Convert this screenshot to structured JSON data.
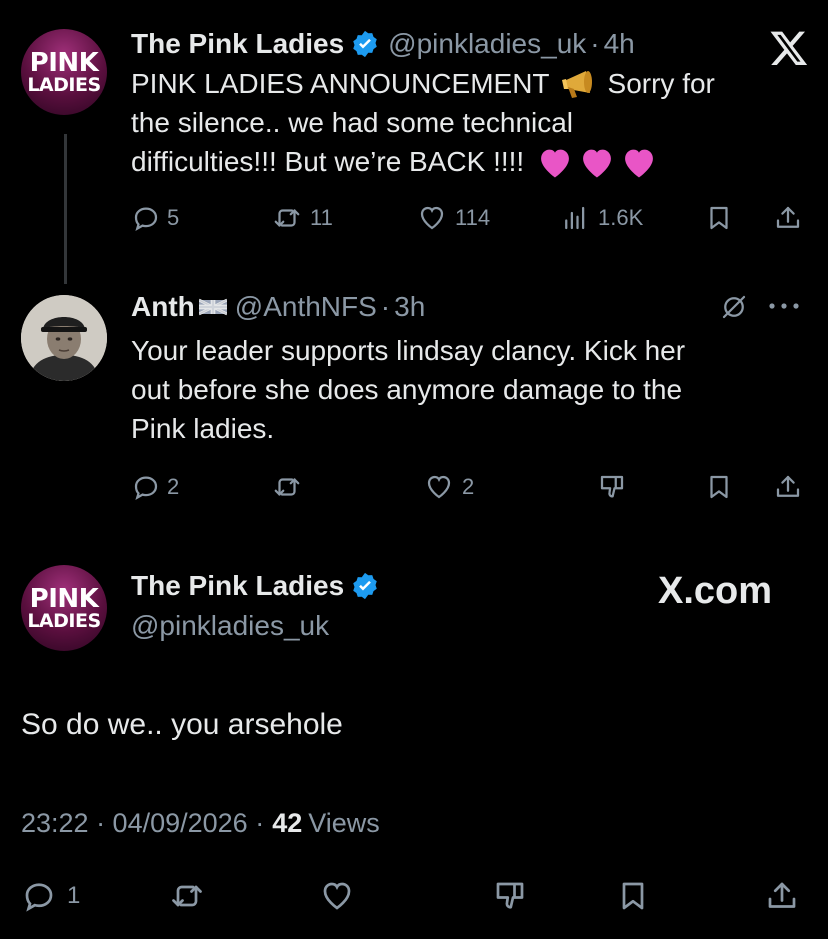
{
  "tweet1": {
    "display_name": "The Pink Ladies",
    "handle": "@pinkladies_uk",
    "time": "4h",
    "avatar_text_line1": "PINK",
    "avatar_text_line2": "LADIES",
    "text_part1": "PINK LADIES ANNOUNCEMENT",
    "text_part2": "Sorry for",
    "text_line2": "the silence.. we had some technical",
    "text_line3": "difficulties!!! But we’re BACK !!!!",
    "hearts": "💗💗💗",
    "megaphone_icon": "megaphone-icon",
    "replies": "5",
    "retweets": "11",
    "likes": "114",
    "views": "1.6K"
  },
  "reply": {
    "display_name": "Anth",
    "flag": "uk-flag-icon",
    "handle": "@AnthNFS",
    "time": "3h",
    "line1": "Your leader supports lindsay clancy. Kick her",
    "line2": "out before she does anymore damage to the",
    "line3": "Pink ladies.",
    "replies": "2",
    "likes": "2"
  },
  "main": {
    "display_name": "The Pink Ladies",
    "handle": "@pinkladies_uk",
    "text": "So do we.. you arsehole",
    "timestamp": "23:22 · 04/09/2026 ·",
    "views_count": "42",
    "views_label": "Views",
    "replies": "1"
  },
  "watermark": "X.com",
  "colors": {
    "verified": "#1d9bf0",
    "muted": "#8b98a5",
    "text": "#e7e9ea",
    "background": "#000000",
    "thread_line": "#333639"
  }
}
